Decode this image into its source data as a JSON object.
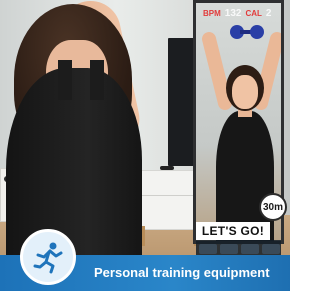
{
  "hud": {
    "bpm_label": "BPM",
    "bpm_value": "132",
    "cal_label": "CAL",
    "cal_value": "2"
  },
  "timer": {
    "label": "30m"
  },
  "mirror": {
    "banner": "LET'S GO!"
  },
  "footer": {
    "icon": "running-person-icon",
    "caption": "Personal training equipment"
  },
  "colors": {
    "accent_blue": "#2a86c9",
    "hud_red": "#e23b3b",
    "dumbbell_blue": "#2a3fa6"
  }
}
